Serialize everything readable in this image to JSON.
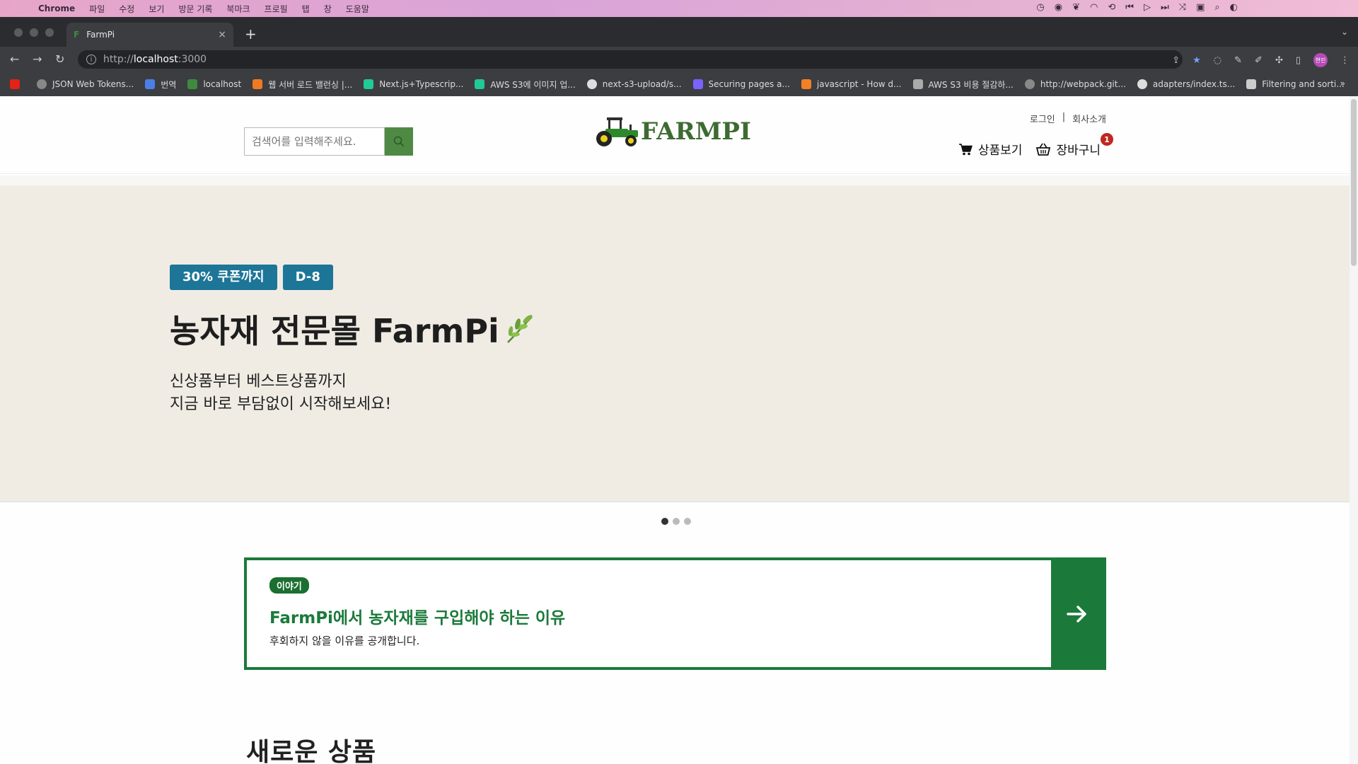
{
  "macos": {
    "menus": [
      "Chrome",
      "파일",
      "수정",
      "보기",
      "방문 기록",
      "북마크",
      "프로필",
      "탭",
      "창",
      "도움말"
    ]
  },
  "browser": {
    "tab_title": "FarmPi",
    "tab_favicon": "F",
    "url_scheme": "http://",
    "url_host": "localhost",
    "url_port": ":3000",
    "profile_label": "현민",
    "bookmarks": [
      {
        "label": "",
        "icon": "youtube-icon",
        "color": "#e62117"
      },
      {
        "label": "JSON Web Tokens...",
        "icon": "globe-icon",
        "color": "#888888"
      },
      {
        "label": "번역",
        "icon": "translate-icon",
        "color": "#4a7fe8"
      },
      {
        "label": "localhost",
        "icon": "farmpi-icon",
        "color": "#3f8a3f"
      },
      {
        "label": "웹 서버 로드 밸런싱 |...",
        "icon": "cube-icon",
        "color": "#f07a21"
      },
      {
        "label": "Next.js+Typescrip...",
        "icon": "velog-icon",
        "color": "#20c997"
      },
      {
        "label": "AWS S3에 이미지 업...",
        "icon": "velog-icon",
        "color": "#20c997"
      },
      {
        "label": "next-s3-upload/s...",
        "icon": "github-icon",
        "color": "#dddddd"
      },
      {
        "label": "Securing pages a...",
        "icon": "shield-icon",
        "color": "#7b61ff"
      },
      {
        "label": "javascript - How d...",
        "icon": "stackoverflow-icon",
        "color": "#f48024"
      },
      {
        "label": "AWS S3 비용 절감하...",
        "icon": "dots-icon",
        "color": "#aaaaaa"
      },
      {
        "label": "http://webpack.git...",
        "icon": "globe-icon",
        "color": "#888888"
      },
      {
        "label": "adapters/index.ts...",
        "icon": "github-icon",
        "color": "#dddddd"
      },
      {
        "label": "Filtering and sorti...",
        "icon": "drop-icon",
        "color": "#cccccc"
      }
    ],
    "bookmarks_more": "»"
  },
  "header": {
    "search_placeholder": "검색어를 입력해주세요.",
    "logo_text": "FARMPI",
    "login": "로그인",
    "separator": "|",
    "about": "회사소개",
    "products": "상품보기",
    "cart": "장바구니",
    "cart_count": "1"
  },
  "hero": {
    "badge_coupon": "30% 쿠폰까지",
    "badge_dday": "D-8",
    "title": "농자재 전문몰 FarmPi",
    "sub_line1": "신상품부터 베스트상품까지",
    "sub_line2": "지금 바로 부담없이 시작해보세요!",
    "slides_total": 3,
    "slide_active": 1
  },
  "story": {
    "tag": "이야기",
    "title": "FarmPi에서 농자재를 구입해야 하는 이유",
    "desc": "후회하지 않을 이유를 공개합니다."
  },
  "section": {
    "new_products": "새로운 상품"
  },
  "colors": {
    "brand_green": "#1b7a3a",
    "search_green": "#4f8a45",
    "badge_blue": "#1d7597",
    "hero_bg": "#f0ece4",
    "cart_badge_red": "#c0281e"
  }
}
